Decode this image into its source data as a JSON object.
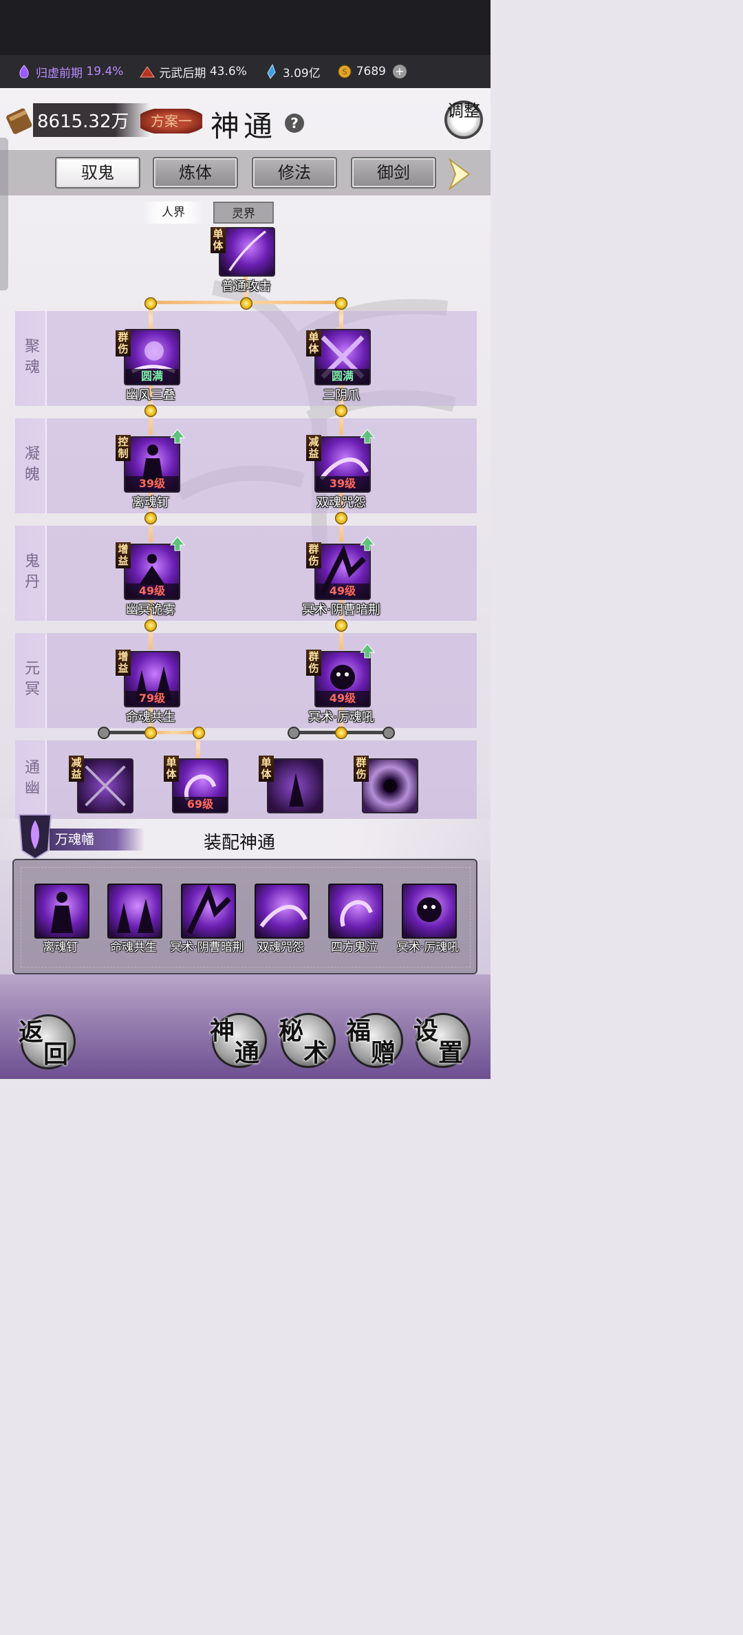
{
  "resources": {
    "cultivation1": {
      "label": "归虚前期",
      "pct": "19.4%",
      "icon": "purple-flame-icon"
    },
    "cultivation2": {
      "label": "元武后期",
      "pct": "43.6%",
      "icon": "red-mountain-icon"
    },
    "spirit_stones": {
      "value": "3.09亿",
      "icon": "blue-crystal-icon"
    },
    "gold": {
      "value": "7689",
      "icon": "gold-coin-icon"
    }
  },
  "header": {
    "score": "8615.32万",
    "plan": "方案一",
    "title": "神通",
    "help": "?",
    "adjust": "调整"
  },
  "tabs": [
    "驭鬼",
    "炼体",
    "修法",
    "御剑"
  ],
  "active_tab": "驭鬼",
  "realms": [
    "人界",
    "灵界"
  ],
  "root_skill": {
    "name": "普通攻击",
    "tag": "单体"
  },
  "rows": [
    {
      "label": "聚魂",
      "skills": [
        {
          "name": "幽风三叠",
          "tag": "群伤",
          "level": "圆满",
          "up": false
        },
        {
          "name": "三阴爪",
          "tag": "单体",
          "level": "圆满",
          "up": false
        }
      ]
    },
    {
      "label": "凝魄",
      "skills": [
        {
          "name": "离魂钉",
          "tag": "控制",
          "level": "39级",
          "up": true
        },
        {
          "name": "双魂咒怨",
          "tag": "减益",
          "level": "39级",
          "up": true
        }
      ]
    },
    {
      "label": "鬼丹",
      "skills": [
        {
          "name": "幽冥诡雾",
          "tag": "增益",
          "level": "49级",
          "up": true
        },
        {
          "name": "冥术·阴曹暗荆",
          "tag": "群伤",
          "level": "49级",
          "up": true
        }
      ]
    },
    {
      "label": "元冥",
      "skills": [
        {
          "name": "命魂共生",
          "tag": "增益",
          "level": "79级",
          "up": false
        },
        {
          "name": "冥术·厉魂吼",
          "tag": "群伤",
          "level": "49级",
          "up": true
        }
      ]
    },
    {
      "label": "通幽",
      "skills": [
        {
          "name": "",
          "tag": "减益",
          "level": ""
        },
        {
          "name": "",
          "tag": "单体",
          "level": "69级"
        },
        {
          "name": "",
          "tag": "单体",
          "level": ""
        },
        {
          "name": "",
          "tag": "群伤",
          "level": ""
        }
      ]
    }
  ],
  "equip": {
    "artifact": "万魂幡",
    "title": "装配神通",
    "skills": [
      "离魂钉",
      "命魂共生",
      "冥术·阴曹暗荆",
      "双魂咒怨",
      "四方鬼泣",
      "冥术·厉魂吼"
    ]
  },
  "nav": {
    "back": [
      "返",
      "回"
    ],
    "buttons": [
      [
        "神",
        "通"
      ],
      [
        "秘",
        "术"
      ],
      [
        "福",
        "赠"
      ],
      [
        "设",
        "置"
      ]
    ]
  }
}
